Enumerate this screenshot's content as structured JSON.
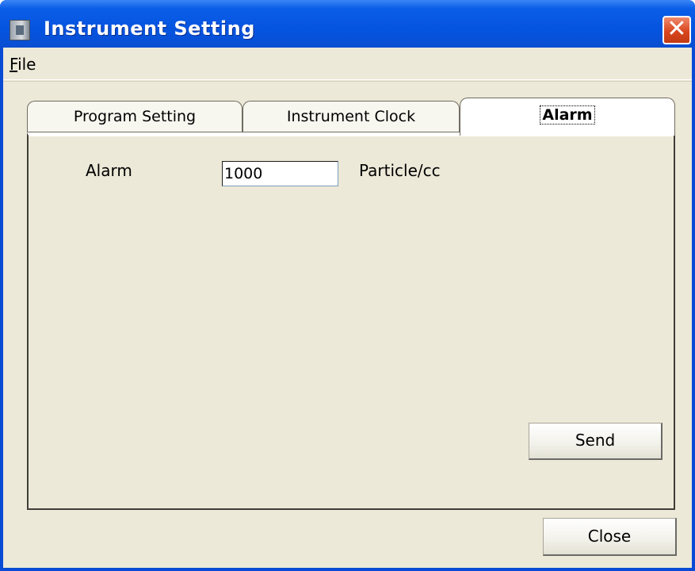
{
  "window": {
    "title": "Instrument Setting",
    "close_glyph": "✕"
  },
  "menu": {
    "file_mnemonic": "F",
    "file_rest": "ile"
  },
  "tabs": [
    {
      "label": "Program Setting",
      "selected": false
    },
    {
      "label": "Instrument Clock",
      "selected": false
    },
    {
      "label": "Alarm",
      "selected": true
    }
  ],
  "alarm_panel": {
    "alarm_label": "Alarm",
    "alarm_value": "1000",
    "unit_label": "Particle/cc",
    "send_label": "Send"
  },
  "footer": {
    "close_label": "Close"
  },
  "colors": {
    "titlebar": "#0554e0",
    "client_bg": "#ece9d8",
    "close_button": "#d9461f"
  },
  "icons": {
    "app": "app-icon",
    "close": "close-x-icon"
  }
}
